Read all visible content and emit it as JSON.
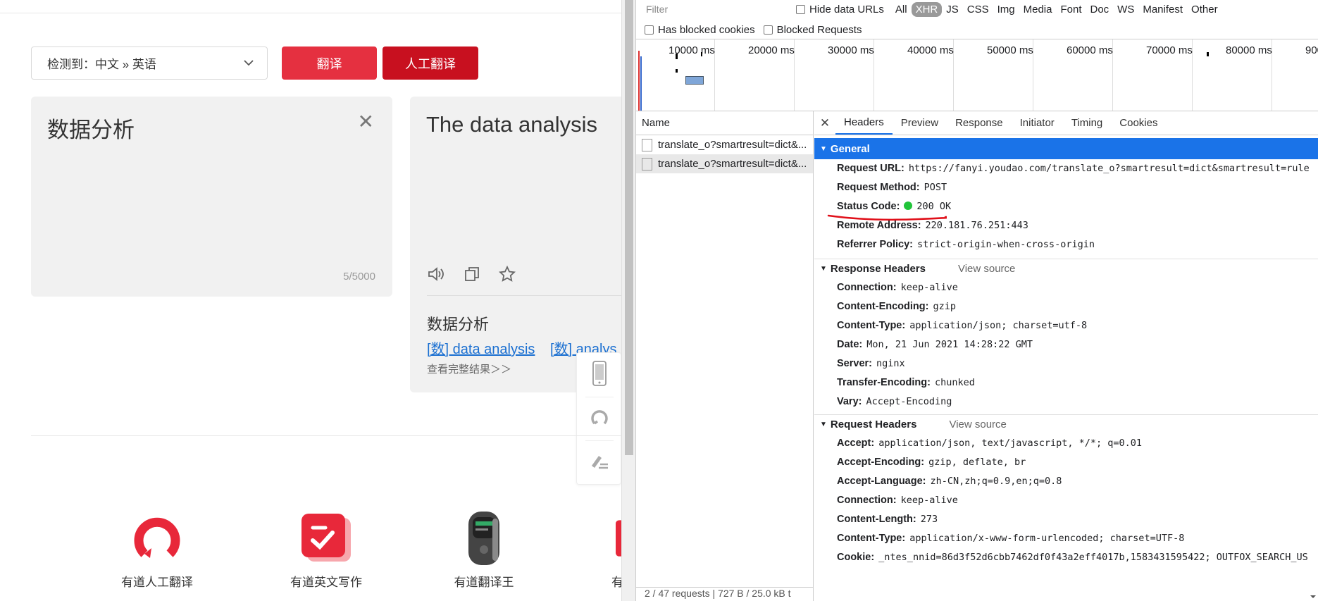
{
  "translator": {
    "lang_select": "检测到：中文  »  英语",
    "translate_btn": "翻译",
    "human_btn": "人工翻译",
    "source_text": "数据分析",
    "char_count": "5/5000",
    "target_text": "The data analysis",
    "dict_word": "数据分析",
    "dict_link1": "[数] data analysis",
    "dict_link2": "[数] analys",
    "more_results": "查看完整结果＞＞",
    "products": [
      {
        "label": "有道人工翻译",
        "icon": "youdao-human-translate-icon"
      },
      {
        "label": "有道英文写作",
        "icon": "youdao-writing-icon"
      },
      {
        "label": "有道翻译王",
        "icon": "translator-device-icon"
      },
      {
        "label": "有",
        "icon": "app-icon"
      }
    ]
  },
  "devtools": {
    "filter_placeholder": "Filter",
    "hide_data_urls": "Hide data URLs",
    "type_filters": [
      "All",
      "XHR",
      "JS",
      "CSS",
      "Img",
      "Media",
      "Font",
      "Doc",
      "WS",
      "Manifest",
      "Other"
    ],
    "active_filter": "XHR",
    "has_blocked_cookies": "Has blocked cookies",
    "blocked_requests": "Blocked Requests",
    "timeline_ticks": [
      "10000 ms",
      "20000 ms",
      "30000 ms",
      "40000 ms",
      "50000 ms",
      "60000 ms",
      "70000 ms",
      "80000 ms",
      "900"
    ],
    "name_header": "Name",
    "requests": [
      "translate_o?smartresult=dict&...",
      "translate_o?smartresult=dict&..."
    ],
    "status_bar": "2 / 47 requests   |   727 B / 25.0 kB t",
    "tabs": [
      "Headers",
      "Preview",
      "Response",
      "Initiator",
      "Timing",
      "Cookies"
    ],
    "active_tab": "Headers",
    "general": {
      "title": "General",
      "request_url_k": "Request URL:",
      "request_url_v": "https://fanyi.youdao.com/translate_o?smartresult=dict&smartresult=rule",
      "method_k": "Request Method:",
      "method_v": "POST",
      "status_k": "Status Code:",
      "status_v": "200 OK",
      "remote_k": "Remote Address:",
      "remote_v": "220.181.76.251:443",
      "referrer_k": "Referrer Policy:",
      "referrer_v": "strict-origin-when-cross-origin"
    },
    "response_headers": {
      "title": "Response Headers",
      "view_source": "View source",
      "rows": [
        {
          "k": "Connection:",
          "v": "keep-alive"
        },
        {
          "k": "Content-Encoding:",
          "v": "gzip"
        },
        {
          "k": "Content-Type:",
          "v": "application/json; charset=utf-8"
        },
        {
          "k": "Date:",
          "v": "Mon, 21 Jun 2021 14:28:22 GMT"
        },
        {
          "k": "Server:",
          "v": "nginx"
        },
        {
          "k": "Transfer-Encoding:",
          "v": "chunked"
        },
        {
          "k": "Vary:",
          "v": "Accept-Encoding"
        }
      ]
    },
    "request_headers": {
      "title": "Request Headers",
      "view_source": "View source",
      "rows": [
        {
          "k": "Accept:",
          "v": "application/json, text/javascript, */*; q=0.01"
        },
        {
          "k": "Accept-Encoding:",
          "v": "gzip, deflate, br"
        },
        {
          "k": "Accept-Language:",
          "v": "zh-CN,zh;q=0.9,en;q=0.8"
        },
        {
          "k": "Connection:",
          "v": "keep-alive"
        },
        {
          "k": "Content-Length:",
          "v": "273"
        },
        {
          "k": "Content-Type:",
          "v": "application/x-www-form-urlencoded; charset=UTF-8"
        },
        {
          "k": "Cookie:",
          "v": "_ntes_nnid=86d3f52d6cbb7462df0f43a2eff4017b,1583431595422; OUTFOX_SEARCH_US"
        }
      ]
    },
    "colors": {
      "accent": "#1a73e8",
      "status_ok": "#21c43a",
      "annotation": "#e0101a"
    }
  }
}
